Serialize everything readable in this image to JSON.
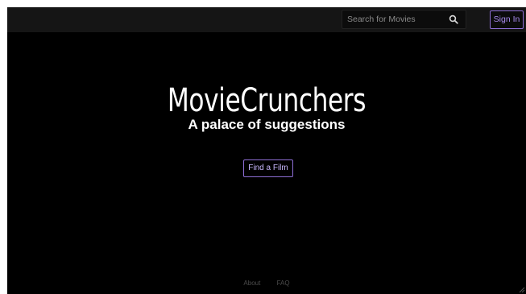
{
  "nav": {
    "search_placeholder": "Search for Movies",
    "search_icon": "magnifier",
    "sign_in_label": "Sign In"
  },
  "hero": {
    "title": "MovieCrunchers",
    "subtitle": "A palace of suggestions",
    "cta_label": "Find a Film"
  },
  "footer": {
    "links": [
      "About",
      "FAQ"
    ]
  },
  "colors": {
    "background": "#000000",
    "topbar": "#151515",
    "accent": "#8e6fd6"
  }
}
